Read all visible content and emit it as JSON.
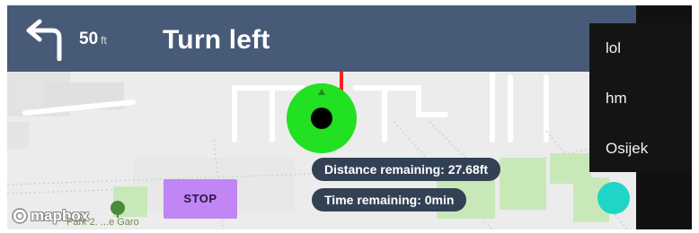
{
  "nav": {
    "distance_value": "50",
    "distance_unit": "ft",
    "instruction": "Turn left",
    "turn_icon": "turn-left-arrow-icon"
  },
  "menu": {
    "items": [
      {
        "label": "lol"
      },
      {
        "label": "hm"
      },
      {
        "label": "Osijek"
      }
    ]
  },
  "map": {
    "distance_remaining": "Distance remaining: 27.68ft",
    "time_remaining": "Time remaining: 0min",
    "stop_label": "STOP",
    "attribution": "mapbox",
    "park_label": "Park 2. ...e Garo"
  },
  "colors": {
    "header": "#475a77",
    "user_location": "#22e022",
    "route": "#ff2020",
    "stop_button": "#c185f5",
    "fab": "#1fd6c6",
    "pill": "#334155"
  }
}
